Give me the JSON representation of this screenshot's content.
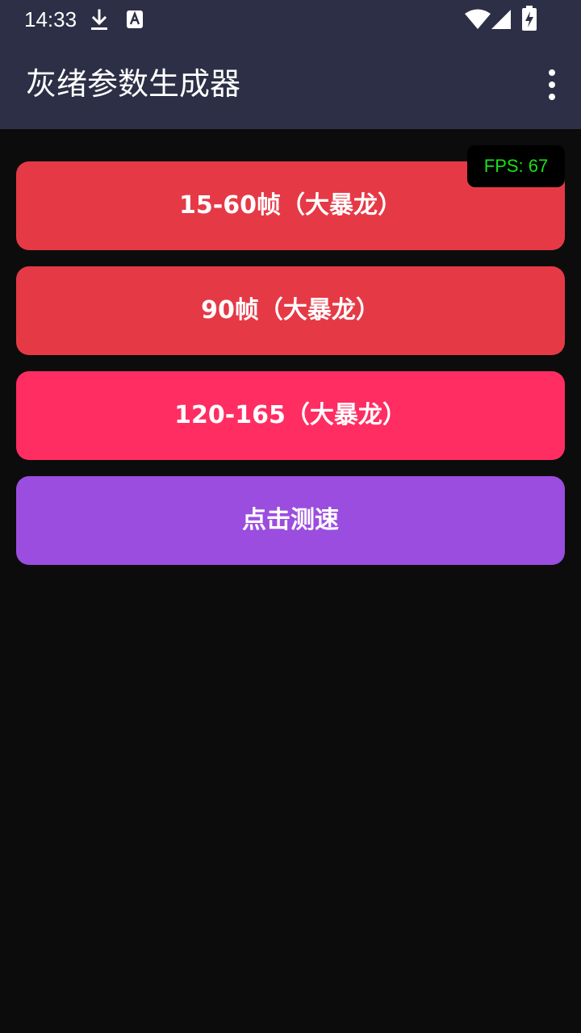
{
  "status_bar": {
    "time": "14:33",
    "icons": [
      "download-icon",
      "text-a-icon",
      "wifi-icon",
      "signal-icon",
      "battery-charging-icon"
    ]
  },
  "app_bar": {
    "title": "灰绪参数生成器",
    "menu_icon": "more-vert-icon"
  },
  "fps_overlay": {
    "text": "FPS: 67",
    "color": "#19e019"
  },
  "buttons": [
    {
      "label": "15-60帧（大暴龙）",
      "color": "#e63946"
    },
    {
      "label": "90帧（大暴龙）",
      "color": "#e63946"
    },
    {
      "label": "120-165（大暴龙）",
      "color": "#ff2d62"
    },
    {
      "label": "点击测速",
      "color": "#9b4ddf"
    }
  ],
  "colors": {
    "app_bar": "#2c2f45",
    "background": "#0c0c0c"
  }
}
